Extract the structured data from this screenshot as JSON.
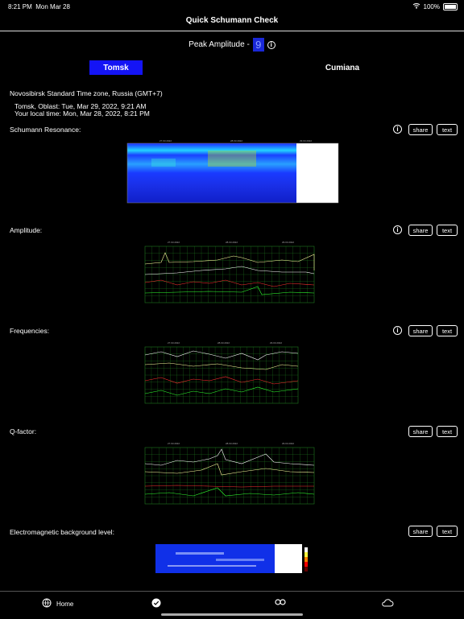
{
  "status": {
    "time": "8:21 PM",
    "date": "Mon Mar 28",
    "battery": "100%"
  },
  "header": {
    "title": "Quick Schumann Check"
  },
  "peak": {
    "label": "Peak Amplitude -",
    "value": "9"
  },
  "tabs": [
    {
      "label": "Tomsk"
    },
    {
      "label": "Cumiana"
    }
  ],
  "location": {
    "zone": "Novosibirsk Standard Time zone, Russia (GMT+7)",
    "station_time": "Tomsk, Oblast: Tue, Mar 29, 2022, 9:21 AM",
    "local_time": "Your local time: Mon, Mar 28, 2022, 8:21 PM"
  },
  "sections": [
    {
      "label": "Schumann Resonance:"
    },
    {
      "label": "Amplitude:"
    },
    {
      "label": "Frequencies:"
    },
    {
      "label": "Q-factor:"
    },
    {
      "label": "Electromagnetic background level:"
    }
  ],
  "buttons": {
    "share": "share",
    "text": "text"
  },
  "chart_dates": [
    "27.03.2022",
    "28.03.2022",
    "29.03.2022"
  ],
  "colors": {
    "accent": "#1414f5",
    "peak_bg": "#1a28d8",
    "grid": "#1f7a1f"
  },
  "tabbar": {
    "home": "Home"
  }
}
